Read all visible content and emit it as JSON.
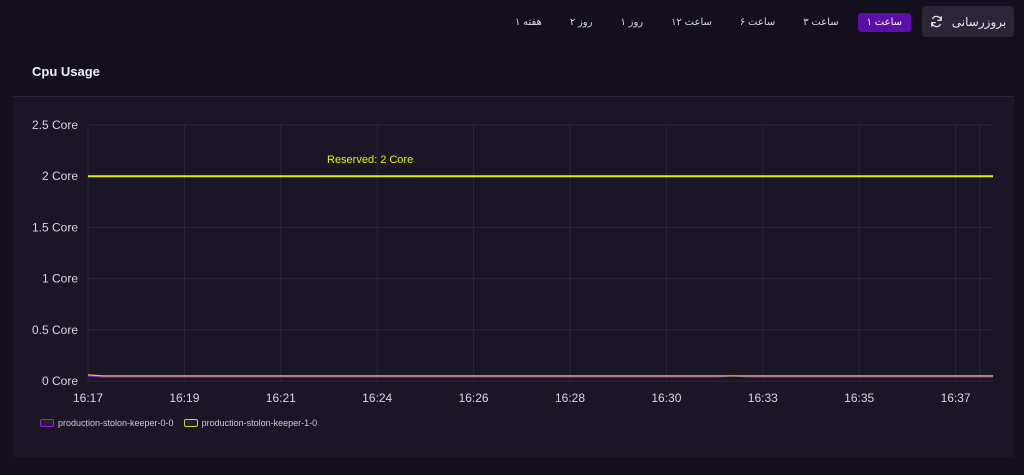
{
  "toolbar": {
    "refresh_label": "بروزرسانی",
    "refresh_icon": "refresh-icon",
    "ranges": [
      {
        "label": "۱ ساعت",
        "active": true
      },
      {
        "label": "۳ ساعت",
        "active": false
      },
      {
        "label": "۶ ساعت",
        "active": false
      },
      {
        "label": "۱۲ ساعت",
        "active": false
      },
      {
        "label": "۱ روز",
        "active": false
      },
      {
        "label": "۲ روز",
        "active": false
      },
      {
        "label": "۱ هفته",
        "active": false
      }
    ]
  },
  "panel": {
    "title": "Cpu Usage"
  },
  "chart_data": {
    "type": "line",
    "y_tick_labels": [
      "0 Core",
      "0.5 Core",
      "1 Core",
      "1.5 Core",
      "2 Core",
      "2.5 Core"
    ],
    "y_ticks": [
      0,
      0.5,
      1,
      1.5,
      2,
      2.5
    ],
    "ylim": [
      0,
      2.5
    ],
    "x_tick_labels": [
      "16:17",
      "16:19",
      "16:21",
      "16:24",
      "16:26",
      "16:28",
      "16:30",
      "16:33",
      "16:35",
      "16:37"
    ],
    "grid": true,
    "legend_position": "bottom-left",
    "threshold": {
      "label": "Reserved: 2 Core",
      "value": 2,
      "color": "#e8f000"
    },
    "series": [
      {
        "name": "production-stolon-keeper-0-0",
        "color": "#a020d0",
        "values": [
          0.05,
          0.04,
          0.04,
          0.04,
          0.04,
          0.04,
          0.04,
          0.04,
          0.04,
          0.04,
          0.04,
          0.04,
          0.04,
          0.04,
          0.04,
          0.04,
          0.04,
          0.04,
          0.04,
          0.04,
          0.04,
          0.04,
          0.04,
          0.04,
          0.04,
          0.04,
          0.04,
          0.04,
          0.04,
          0.04,
          0.04,
          0.04,
          0.04,
          0.04,
          0.04,
          0.04,
          0.04,
          0.04,
          0.04,
          0.04,
          0.04,
          0.04,
          0.05,
          0.04,
          0.04,
          0.04,
          0.04,
          0.04,
          0.04,
          0.04,
          0.04,
          0.04,
          0.04,
          0.04,
          0.04,
          0.04,
          0.04,
          0.04,
          0.04,
          0.04
        ]
      },
      {
        "name": "production-stolon-keeper-1-0",
        "color": "#c8d22a",
        "values": [
          0.06,
          0.05,
          0.05,
          0.05,
          0.05,
          0.05,
          0.05,
          0.05,
          0.05,
          0.05,
          0.05,
          0.05,
          0.05,
          0.05,
          0.05,
          0.05,
          0.05,
          0.05,
          0.05,
          0.05,
          0.05,
          0.05,
          0.05,
          0.05,
          0.05,
          0.05,
          0.05,
          0.05,
          0.05,
          0.05,
          0.05,
          0.05,
          0.05,
          0.05,
          0.05,
          0.05,
          0.05,
          0.05,
          0.05,
          0.05,
          0.05,
          0.05,
          0.05,
          0.05,
          0.05,
          0.05,
          0.05,
          0.05,
          0.05,
          0.05,
          0.05,
          0.05,
          0.05,
          0.05,
          0.05,
          0.05,
          0.05,
          0.05,
          0.05,
          0.05
        ]
      }
    ]
  },
  "colors": {
    "accent": "#5b0fa8",
    "background": "#130f1c",
    "panel": "#1b1626",
    "threshold": "#e8f000"
  }
}
